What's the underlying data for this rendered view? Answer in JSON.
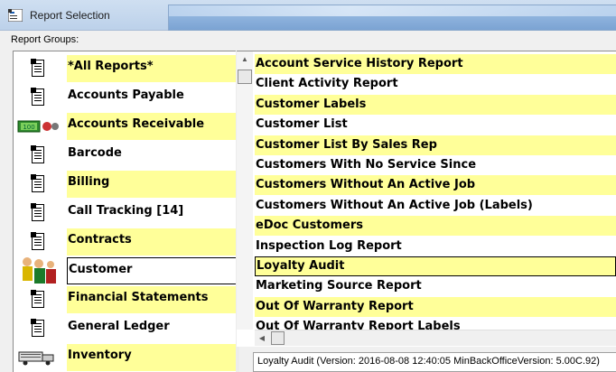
{
  "window": {
    "title": "Report Selection"
  },
  "groups_caption": "Report Groups:",
  "groups": [
    {
      "label": "*All Reports*",
      "icon": "document-icon",
      "highlight": true
    },
    {
      "label": "Accounts Payable",
      "icon": "document-icon",
      "highlight": false
    },
    {
      "label": "Accounts Receivable",
      "icon": "money-icon",
      "highlight": true
    },
    {
      "label": "Barcode",
      "icon": "document-icon",
      "highlight": false
    },
    {
      "label": "Billing",
      "icon": "document-icon",
      "highlight": true
    },
    {
      "label": "Call Tracking [14]",
      "icon": "document-icon",
      "highlight": false
    },
    {
      "label": "Contracts",
      "icon": "document-icon",
      "highlight": true
    },
    {
      "label": "Customer",
      "icon": "customer-people-icon",
      "highlight": false,
      "selected": true
    },
    {
      "label": "Financial Statements",
      "icon": "document-icon",
      "highlight": true
    },
    {
      "label": "General Ledger",
      "icon": "document-icon",
      "highlight": false
    },
    {
      "label": "Inventory",
      "icon": "truck-icon",
      "highlight": true
    }
  ],
  "reports": [
    {
      "label": "Account Service History Report",
      "highlight": true
    },
    {
      "label": "Client Activity Report",
      "highlight": false
    },
    {
      "label": "Customer Labels",
      "highlight": true
    },
    {
      "label": "Customer List",
      "highlight": false
    },
    {
      "label": "Customer List By Sales Rep",
      "highlight": true
    },
    {
      "label": "Customers With No Service Since",
      "highlight": false
    },
    {
      "label": "Customers Without An Active Job",
      "highlight": true
    },
    {
      "label": "Customers Without An Active Job (Labels)",
      "highlight": false
    },
    {
      "label": "eDoc Customers",
      "highlight": true
    },
    {
      "label": "Inspection Log Report",
      "highlight": false
    },
    {
      "label": "Loyalty Audit",
      "highlight": true,
      "selected": true
    },
    {
      "label": "Marketing Source Report",
      "highlight": false
    },
    {
      "label": "Out Of Warranty Report",
      "highlight": true
    },
    {
      "label": "Out Of Warranty Report Labels",
      "highlight": false
    }
  ],
  "status_text": "Loyalty Audit (Version: 2016-08-08 12:40:05  MinBackOfficeVersion: 5.00C.92)",
  "colors": {
    "highlight": "#ffff99",
    "title_bar": "#c6d8ee"
  }
}
